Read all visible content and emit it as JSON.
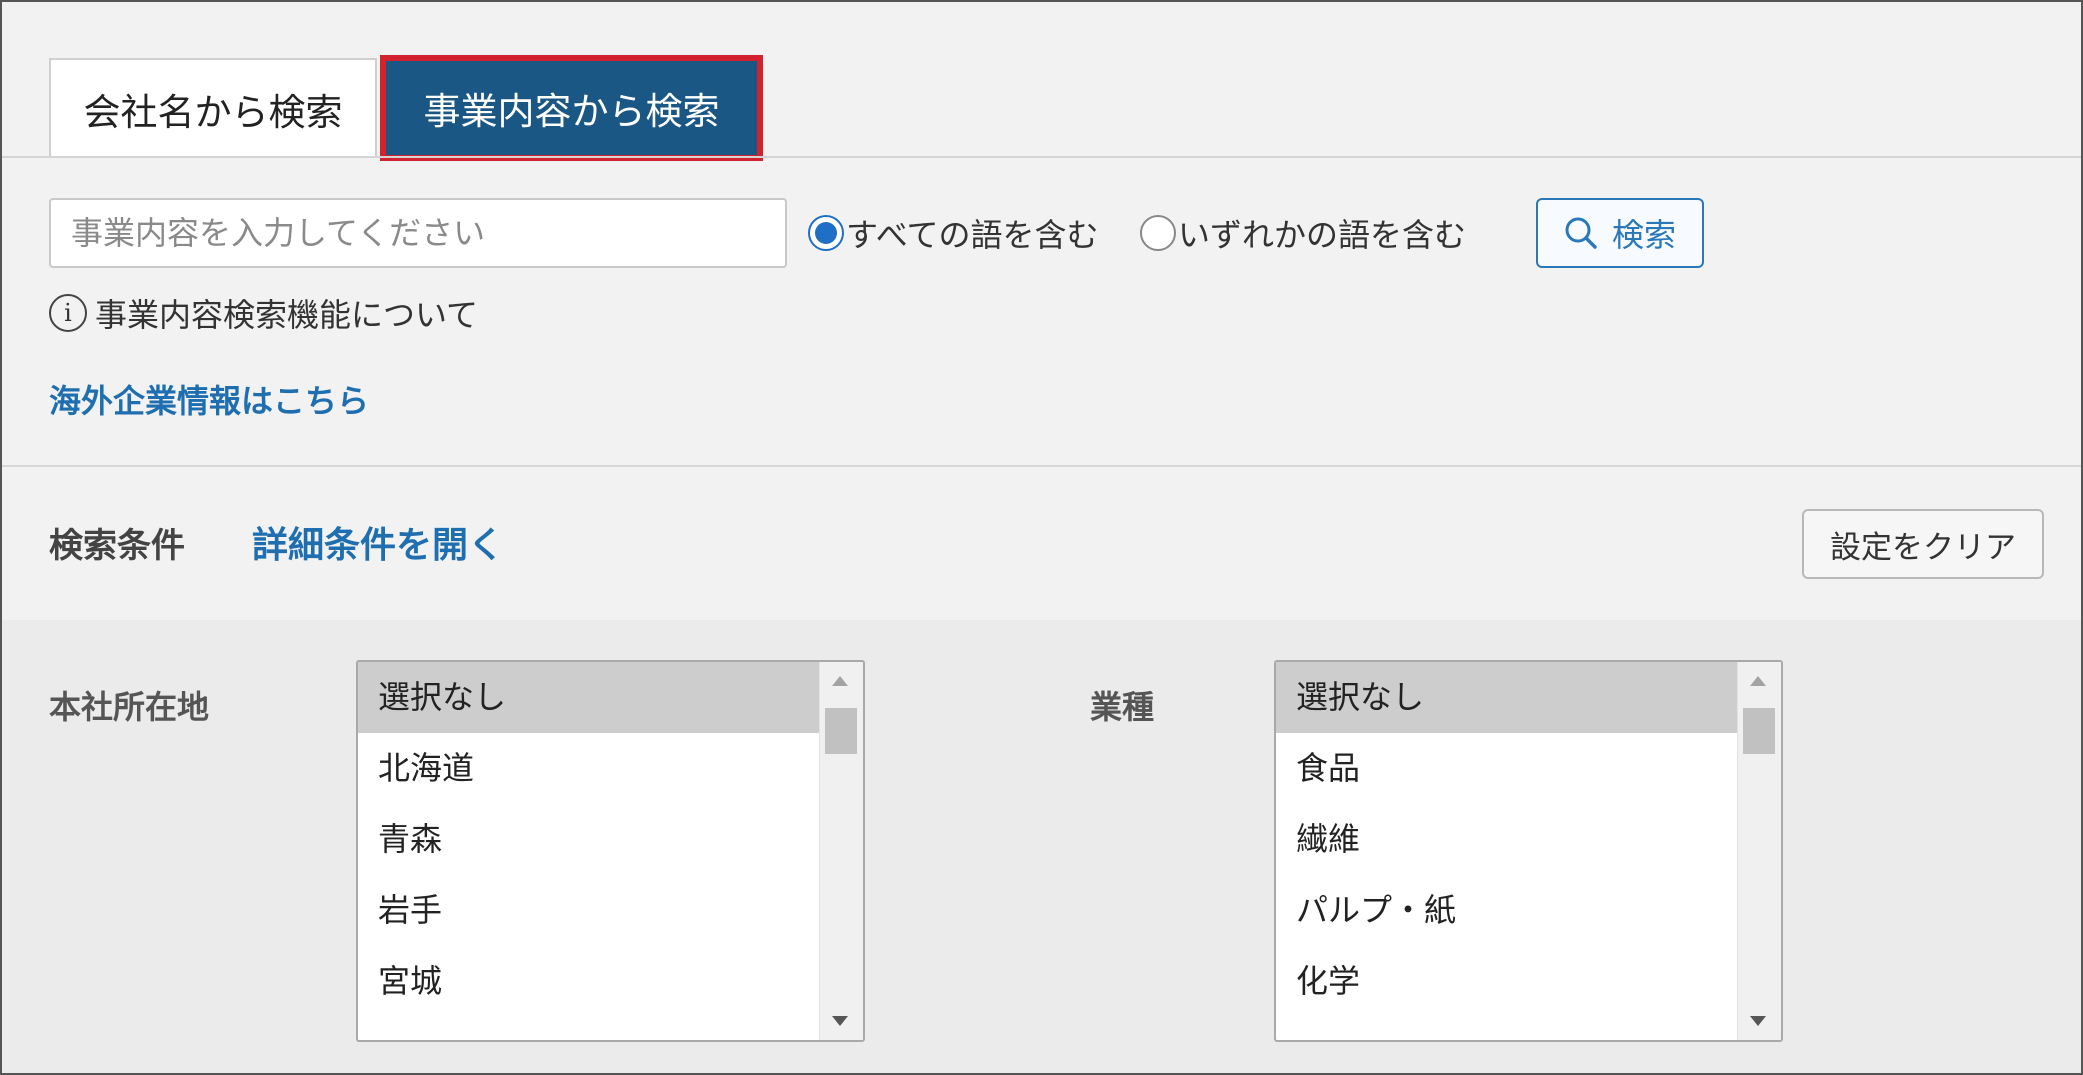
{
  "tabs": {
    "company_name": "会社名から検索",
    "business_content": "事業内容から検索"
  },
  "search": {
    "placeholder": "事業内容を入力してください",
    "radio_all": "すべての語を含む",
    "radio_any": "いずれかの語を含む",
    "button_label": "検索",
    "info_text": "事業内容検索機能について",
    "overseas_link": "海外企業情報はこちら"
  },
  "conditions": {
    "label": "検索条件",
    "detail_link": "詳細条件を開く",
    "clear_button": "設定をクリア"
  },
  "filters": {
    "location": {
      "label": "本社所在地",
      "options": [
        "選択なし",
        "北海道",
        "青森",
        "岩手",
        "宮城"
      ]
    },
    "industry": {
      "label": "業種",
      "options": [
        "選択なし",
        "食品",
        "繊維",
        "パルプ・紙",
        "化学"
      ]
    }
  },
  "colors": {
    "active_tab": "#1b5784",
    "active_tab_highlight": "#d2222d",
    "link": "#1f6fb0"
  },
  "icons": {
    "search": "search-icon",
    "info": "info-icon"
  }
}
